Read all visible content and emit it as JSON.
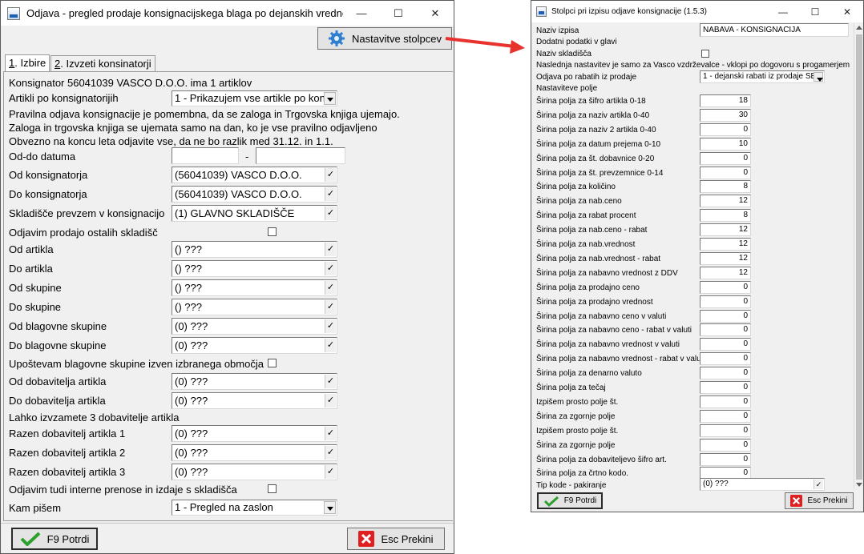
{
  "colors": {
    "accent_blue": "#1f5fb0",
    "ok_green": "#2ca02c",
    "cancel_red": "#e02020",
    "arrow_red": "#e8322e"
  },
  "main": {
    "title": "Odjava - pregled prodaje konsignacijskega blaga po dejanskih vrednostih ...",
    "title_buttons": [
      "—",
      "☐",
      "✕"
    ],
    "settings_button": "Nastavitve stolpcev",
    "tabs": [
      {
        "key": "1",
        "label": ". Izbire"
      },
      {
        "key": "2",
        "label": ". Izvzeti konsinatorji"
      }
    ],
    "info_line": "Konsignator 56041039  VASCO D.O.O.  ima   1 artiklov",
    "artikli_label": "Artikli po konsignatorijih",
    "artikli_value": "1 - Prikazujem vse artikle po kon",
    "notes": [
      "Pravilna odjava konsignacije je pomembna, da se zaloga in Trgovska knjiga ujemajo.",
      "Zaloga in trgovska knjiga se ujemata samo na dan, ko je vse pravilno odjavljeno",
      "Obvezno na koncu leta odjavite vse, da ne bo razlik med 31.12. in 1.1."
    ],
    "date_label": "Od-do datuma",
    "date_from": "",
    "date_sep": "-",
    "date_to": "",
    "fields": [
      {
        "label": "Od konsignatorja",
        "value": "(56041039) VASCO D.O.O."
      },
      {
        "label": "Do konsignatorja",
        "value": "(56041039) VASCO D.O.O."
      },
      {
        "label": "Skladišče prevzem v konsignacijo",
        "value": "(1) GLAVNO SKLADIŠČE"
      }
    ],
    "odjavim_label": "Odjavim prodajo ostalih skladišč",
    "fields2": [
      {
        "label": "Od artikla",
        "value": "() ???"
      },
      {
        "label": "Do artikla",
        "value": "() ???"
      },
      {
        "label": "Od skupine",
        "value": "() ???"
      },
      {
        "label": "Do skupine",
        "value": "() ???"
      },
      {
        "label": "Od blagovne skupine",
        "value": "(0) ???"
      },
      {
        "label": "Do blagovne skupine",
        "value": "(0) ???"
      }
    ],
    "upostevam_label": "Upoštevam blagovne skupine izven izbranega območja",
    "fields3": [
      {
        "label": "Od dobavitelja artikla",
        "value": "(0) ???"
      },
      {
        "label": "Do dobavitelja artikla",
        "value": "(0) ???"
      }
    ],
    "izvzamete_label": "Lahko izvzamete 3 dobavitelje artikla",
    "fields4": [
      {
        "label": "Razen dobavitelj artikla 1",
        "value": "(0) ???"
      },
      {
        "label": "Razen dobavitelj artikla 2",
        "value": "(0) ???"
      },
      {
        "label": "Razen dobavitelj artikla 3",
        "value": "(0) ???"
      }
    ],
    "interne_label": "Odjavim tudi interne prenose in izdaje s skladišča",
    "kam_label": "Kam pišem",
    "kam_value": "1 - Pregled na zaslon",
    "ok_button": "F9 Potrdi",
    "cancel_button": "Esc Prekini"
  },
  "cols": {
    "title": "Stolpci pri izpisu odjave konsignacije  (1.5.3)",
    "title_buttons": [
      "—",
      "☐",
      "✕"
    ],
    "naziv_label": "Naziv izpisa",
    "naziv_value": "NABAVA - KONSIGNACIJA",
    "dodatni_label": "Dodatni podatki v glavi",
    "naziv_skl_label": "Naziv skladišča",
    "note": "Naslednja nastavitev je samo za Vasco vzdrževalce - vklopi po dogovoru s progamerjem",
    "odjava_label": "Odjava po rabatih iz prodaje",
    "odjava_value": "1 - dejanski rabati iz prodaje SE",
    "nastavitve_label": "Nastaviteve polje",
    "rows": [
      {
        "label": "Širina polja za šifro artikla 0-18",
        "value": "18"
      },
      {
        "label": "Širina polja za naziv artikla 0-40",
        "value": "30"
      },
      {
        "label": "Širina polja za naziv 2 artikla 0-40",
        "value": "0"
      },
      {
        "label": "Širina polja za datum prejema 0-10",
        "value": "10"
      },
      {
        "label": "Širina polja za št. dobavnice 0-20",
        "value": "0"
      },
      {
        "label": "Širina polja za št. prevzemnice 0-14",
        "value": "0"
      },
      {
        "label": "Širina polja za količino",
        "value": "8"
      },
      {
        "label": "Širina polja za nab.ceno",
        "value": "12"
      },
      {
        "label": "Širina polja za rabat procent",
        "value": "8"
      },
      {
        "label": "Širina polja za nab.ceno - rabat",
        "value": "12"
      },
      {
        "label": "Širina polja za nab.vrednost",
        "value": "12"
      },
      {
        "label": "Širina polja za nab.vrednost - rabat",
        "value": "12"
      },
      {
        "label": "Širina polja za nabavno vrednost z DDV",
        "value": "12"
      },
      {
        "label": "Širina polja za prodajno ceno",
        "value": "0"
      },
      {
        "label": "Širina polja za prodajno vrednost",
        "value": "0"
      },
      {
        "label": "Širina polja za nabavno ceno v valuti",
        "value": "0"
      },
      {
        "label": "Širina polja za nabavno ceno - rabat v valuti",
        "value": "0"
      },
      {
        "label": "Širina polja za nabavno vrednost v valuti",
        "value": "0"
      },
      {
        "label": "Širina polja za nabavno vrednost - rabat v valuti",
        "value": "0"
      },
      {
        "label": "Širina polja za denarno valuto",
        "value": "0"
      },
      {
        "label": "Širina polja za tečaj",
        "value": "0"
      },
      {
        "label": "Izpišem prosto polje št.",
        "value": "0"
      },
      {
        "label": "Širina za zgornje polje",
        "value": "0"
      },
      {
        "label": "Izpišem prosto polje št.",
        "value": "0"
      },
      {
        "label": "Širina za zgornje polje",
        "value": "0"
      },
      {
        "label": "Širina polja za dobaviteljevo šifro art.",
        "value": "0"
      },
      {
        "label": "Širina polja za črtno kodo.",
        "value": "0"
      }
    ],
    "tip_label": "Tip kode - pakiranje",
    "tip_value": "(0) ???",
    "ok_button": "F9 Potrdi",
    "cancel_button": "Esc Prekini"
  }
}
